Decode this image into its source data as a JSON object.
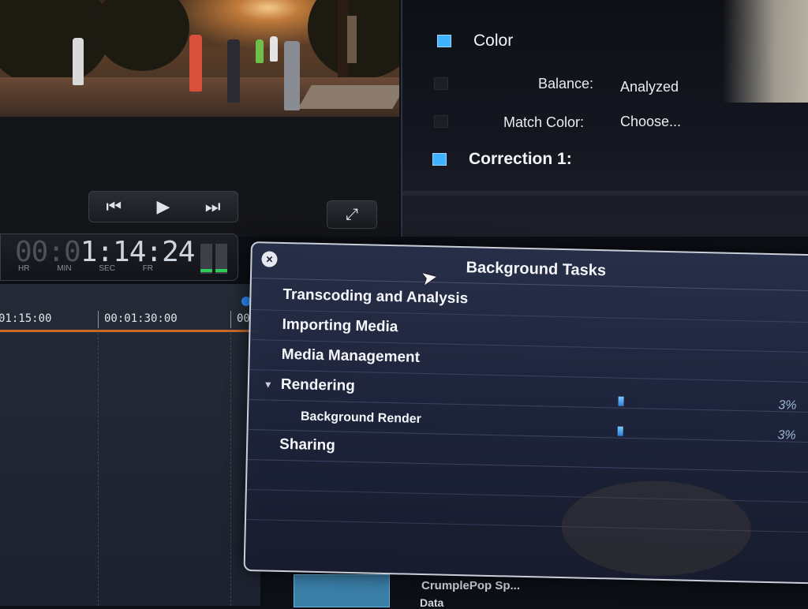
{
  "viewer": {
    "prev_icon": "skip-back-icon",
    "play_icon": "play-icon",
    "next_icon": "skip-forward-icon",
    "fullscreen_icon": "expand-arrows-icon"
  },
  "inspector": {
    "color_heading": "Color",
    "balance_label": "Balance:",
    "balance_value": "Analyzed",
    "match_color_label": "Match Color:",
    "match_color_value": "Choose...",
    "correction_heading": "Correction 1:",
    "checkbox_color": "#3fb3ff"
  },
  "timecode": {
    "dim_prefix": "00:0",
    "value": "1:14:24",
    "unit_labels": [
      "HR",
      "MIN",
      "SEC",
      "FR"
    ]
  },
  "timeline": {
    "ruler_labels": [
      "01:15:00",
      "00:01:30:00",
      "00"
    ]
  },
  "background_tasks": {
    "title": "Background Tasks",
    "close_icon": "close-icon",
    "tasks": [
      {
        "label": "Transcoding and Analysis"
      },
      {
        "label": "Importing Media"
      },
      {
        "label": "Media Management"
      },
      {
        "label": "Rendering",
        "expanded": true
      },
      {
        "label": "Background Render",
        "progress": 0.03,
        "percent": "3%"
      },
      {
        "label": "Sharing",
        "progress": 0.03,
        "percent": "3%"
      }
    ]
  },
  "partial_text": {
    "clip_label": "CrumplePop Sp...",
    "data_label": "Data"
  }
}
